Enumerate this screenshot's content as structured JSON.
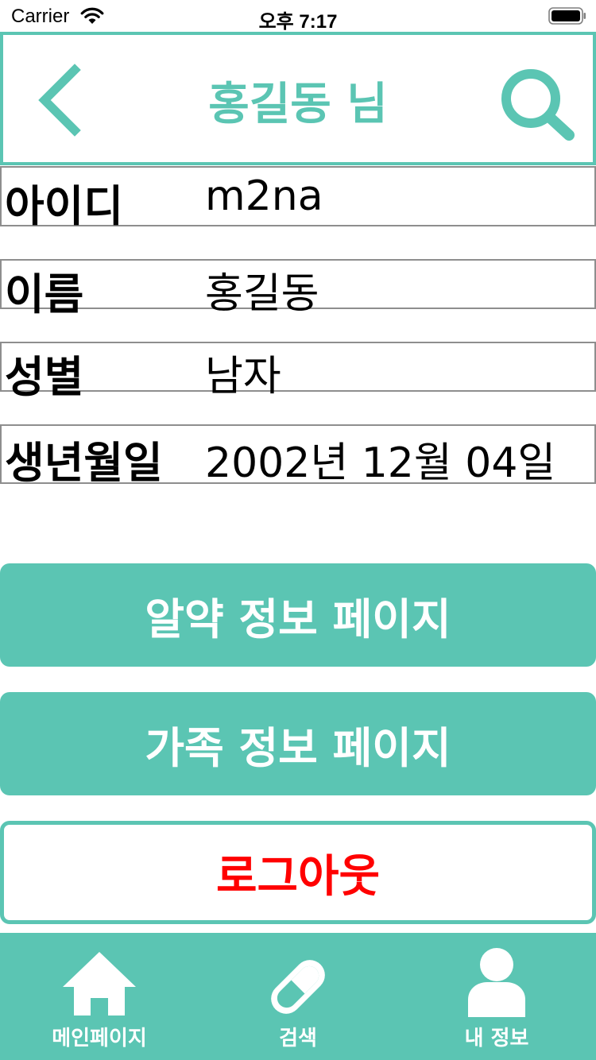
{
  "status_bar": {
    "carrier": "Carrier",
    "time": "오후 7:17"
  },
  "header": {
    "title": "홍길동 님",
    "back_icon": "chevron-left-icon",
    "search_icon": "search-icon"
  },
  "info": [
    {
      "label": "아이디",
      "value": "m2na"
    },
    {
      "label": "이름",
      "value": "홍길동"
    },
    {
      "label": "성별",
      "value": "남자"
    },
    {
      "label": "생년월일",
      "value": "2002년 12월 04일"
    }
  ],
  "buttons": {
    "medicine_info": "알약 정보 페이지",
    "family_info": "가족 정보 페이지",
    "logout": "로그아웃"
  },
  "tab_bar": {
    "items": [
      {
        "label": "메인페이지",
        "icon": "home-icon"
      },
      {
        "label": "검색",
        "icon": "pill-icon"
      },
      {
        "label": "내 정보",
        "icon": "user-icon"
      }
    ]
  },
  "colors": {
    "accent": "#5bc5b3",
    "logout_text": "#ff0000",
    "row_border": "#8e8e8e"
  }
}
